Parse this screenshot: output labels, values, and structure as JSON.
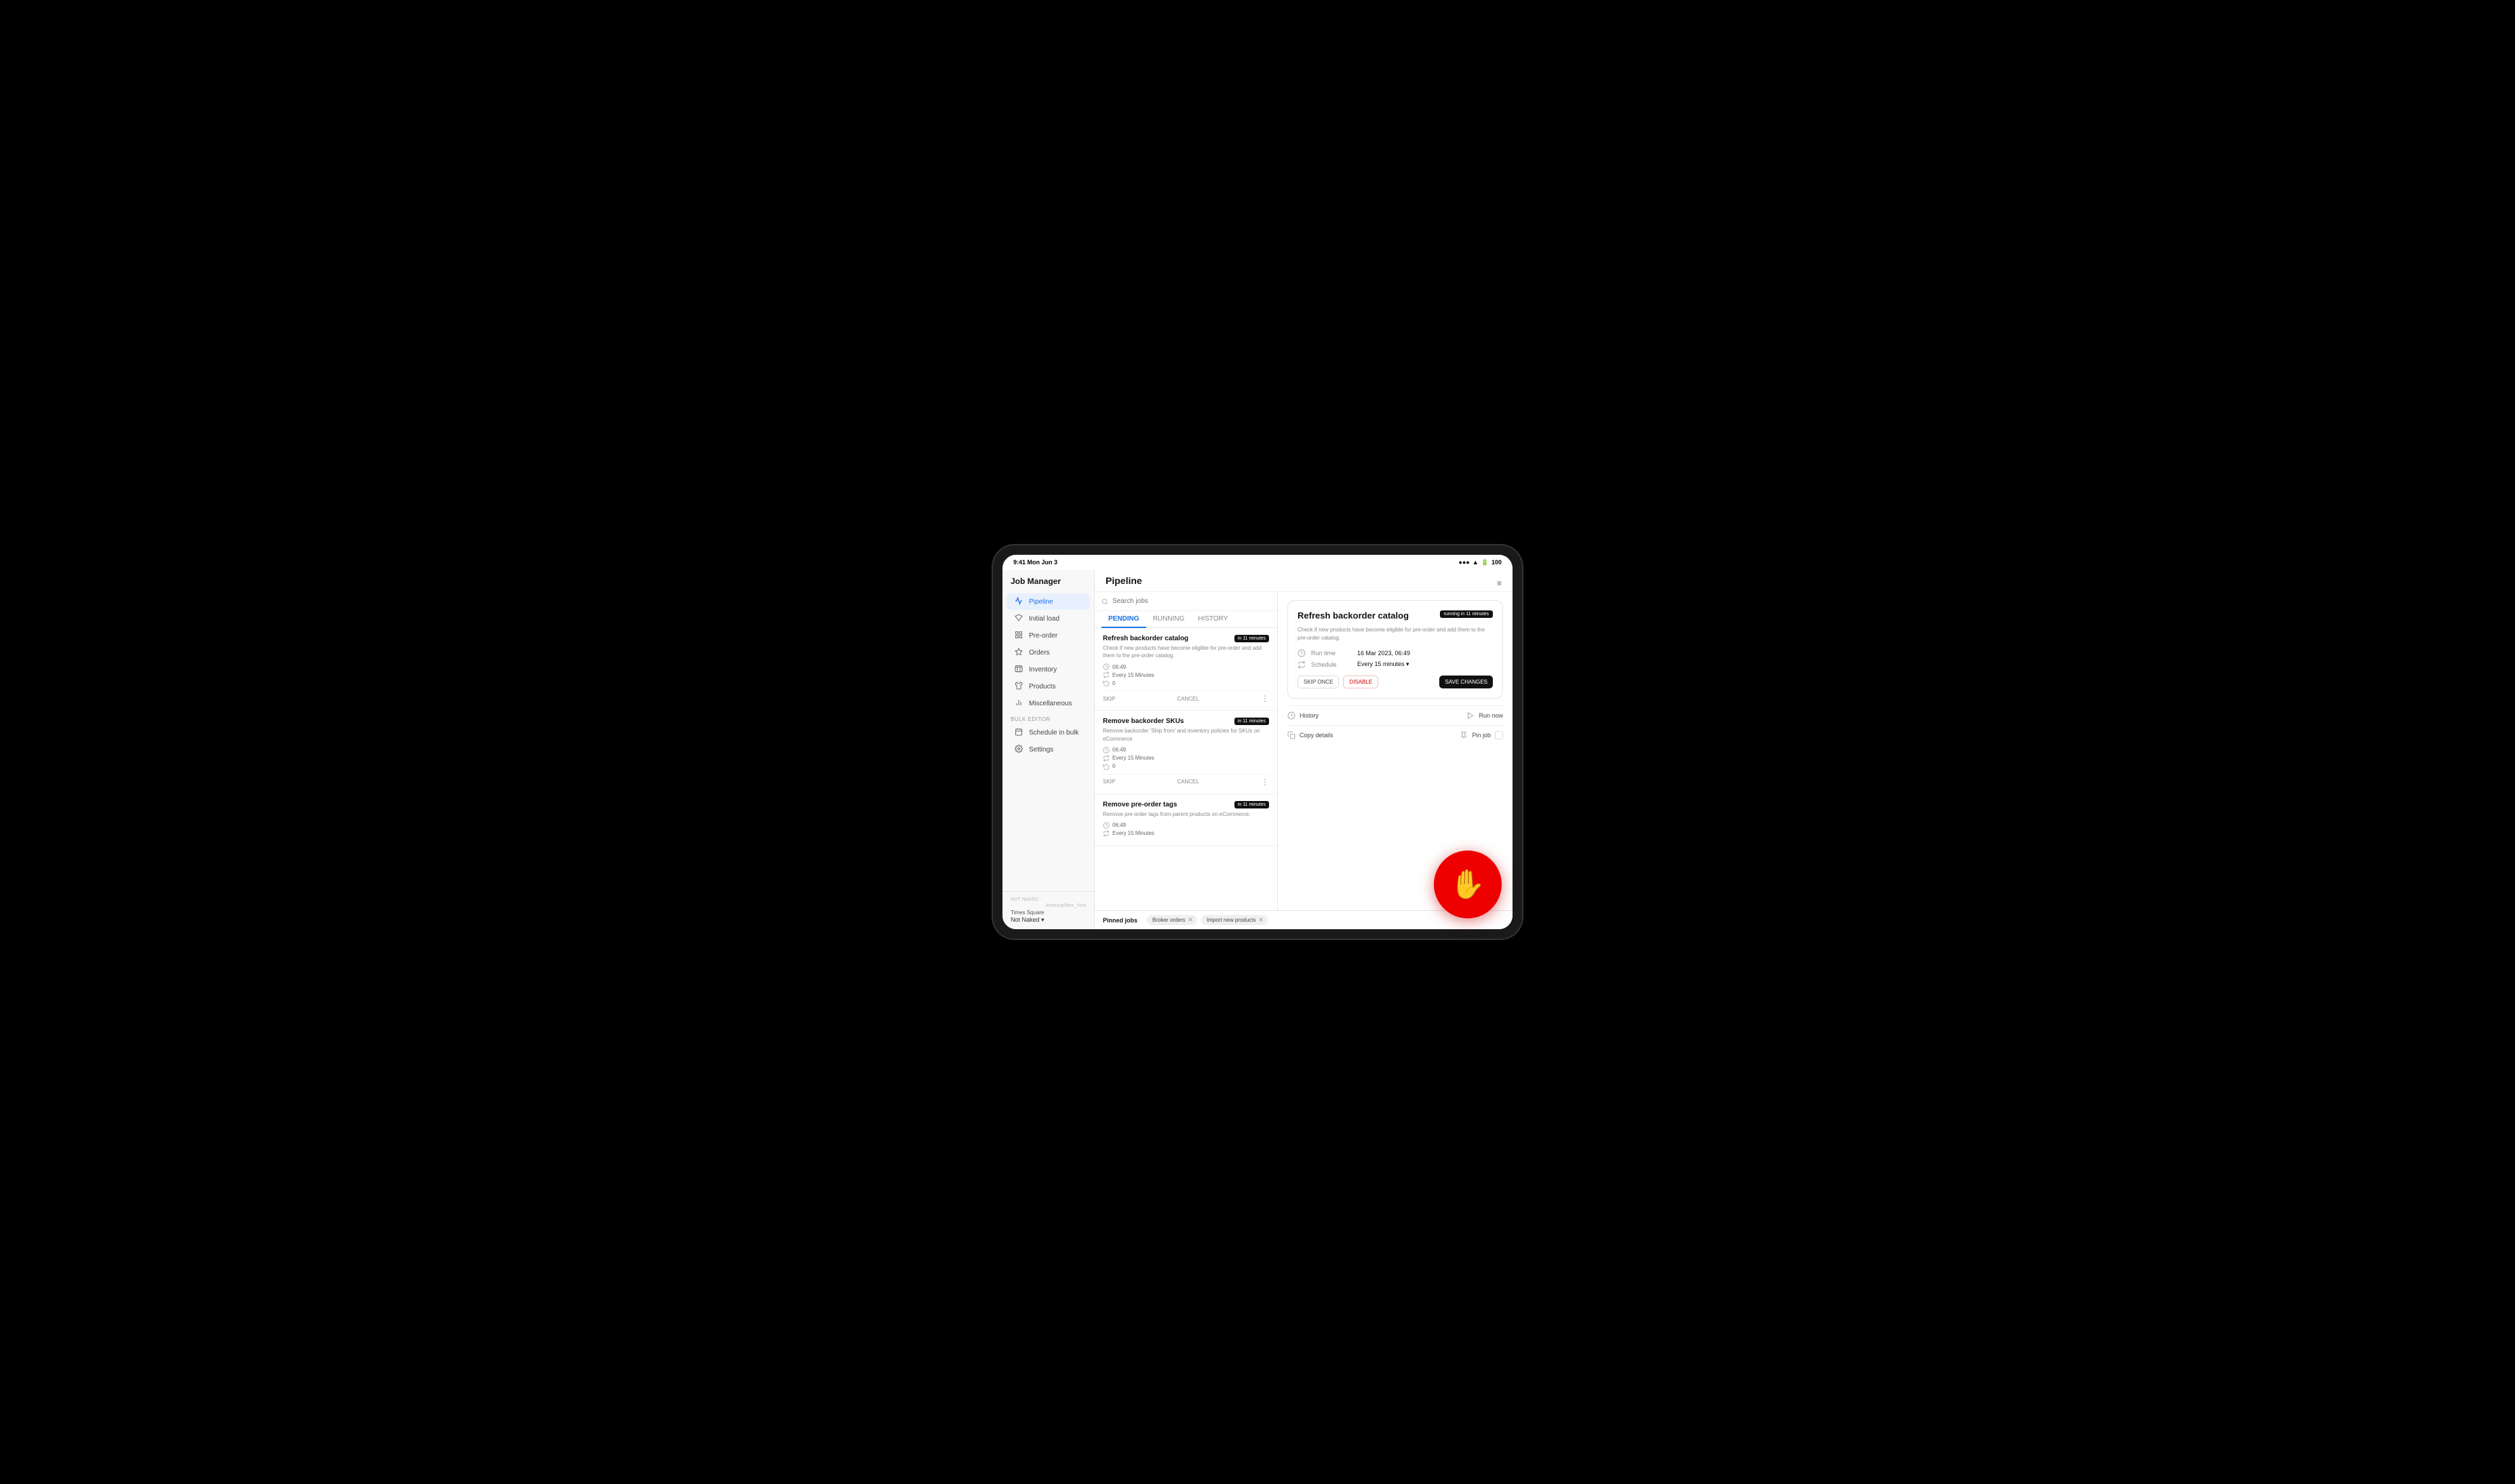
{
  "statusBar": {
    "time": "9:41 Mon Jun 3",
    "battery": "100",
    "signal": "●●●●"
  },
  "sidebar": {
    "appTitle": "Job Manager",
    "nav": [
      {
        "id": "pipeline",
        "label": "Pipeline",
        "icon": "activity",
        "active": true
      },
      {
        "id": "initial-load",
        "label": "Initial load",
        "icon": "diamond"
      },
      {
        "id": "pre-order",
        "label": "Pre-order",
        "icon": "grid"
      },
      {
        "id": "orders",
        "label": "Orders",
        "icon": "diamond-sm"
      },
      {
        "id": "inventory",
        "label": "Inventory",
        "icon": "box"
      },
      {
        "id": "products",
        "label": "Products",
        "icon": "shirt"
      },
      {
        "id": "miscellaneous",
        "label": "Miscellaneous",
        "icon": "bar-chart"
      }
    ],
    "bulkEditorLabel": "Bulk editor",
    "bulkEditorItems": [
      {
        "id": "schedule-bulk",
        "label": "Schedule in bulk",
        "icon": "calendar"
      },
      {
        "id": "settings",
        "label": "Settings",
        "icon": "gear"
      }
    ],
    "footerBrand": "NOT NAKED",
    "footerTimezone": "America/New_York",
    "footerLocation": "Times Square",
    "footerStore": "Not Naked ▾"
  },
  "mainHeader": {
    "title": "Pipeline",
    "filterIcon": "≡"
  },
  "searchBar": {
    "placeholder": "Search jobs"
  },
  "tabs": [
    {
      "id": "pending",
      "label": "PENDING",
      "active": true
    },
    {
      "id": "running",
      "label": "RUNNING"
    },
    {
      "id": "history",
      "label": "HISTORY"
    }
  ],
  "jobs": [
    {
      "id": "job1",
      "title": "Refresh backorder catalog",
      "badge": "in 11 minutes",
      "description": "Check if new products have become eligible for pre-order and add them to the pre-order catalog.",
      "time": "06:49",
      "schedule": "Every 15 Minutes",
      "retries": "0",
      "skipLabel": "SKIP",
      "cancelLabel": "CANCEL"
    },
    {
      "id": "job2",
      "title": "Remove backorder SKUs",
      "badge": "in 11 minutes",
      "description": "Remove backorder 'Ship from' and inventory policies for SKUs on eCommerce",
      "time": "06:49",
      "schedule": "Every 15 Minutes",
      "retries": "0",
      "skipLabel": "SKIP",
      "cancelLabel": "CANCEL"
    },
    {
      "id": "job3",
      "title": "Remove pre-order tags",
      "badge": "in 11 minutes",
      "description": "Remove pre-order tags from parent products on eCommerce.",
      "time": "06:49",
      "schedule": "Every 15 Minutes",
      "retries": null,
      "skipLabel": "SKIP",
      "cancelLabel": "CANCEL"
    }
  ],
  "detailPanel": {
    "title": "Refresh backorder catalog",
    "runningBadge": "running in 11 minutes",
    "description": "Check if new products have become eligible for pre-order and add them to the pre-order catalog.",
    "runTimeLabel": "Run time",
    "runTimeValue": "16 Mar 2023, 06:49",
    "scheduleLabel": "Schedule",
    "scheduleValue": "Every 15 minutes ▾",
    "buttons": {
      "skipOnce": "SKIP ONCE",
      "disable": "DISABLE",
      "saveChanges": "SAVE CHANGES"
    },
    "historyLabel": "History",
    "runNowLabel": "Run now",
    "copyDetailsLabel": "Copy details",
    "pinJobLabel": "Pin job"
  },
  "pinnedBar": {
    "label": "Pinned jobs",
    "tags": [
      {
        "id": "broker-orders",
        "label": "Broker orders"
      },
      {
        "id": "import-new-products",
        "label": "Import new products"
      }
    ]
  }
}
